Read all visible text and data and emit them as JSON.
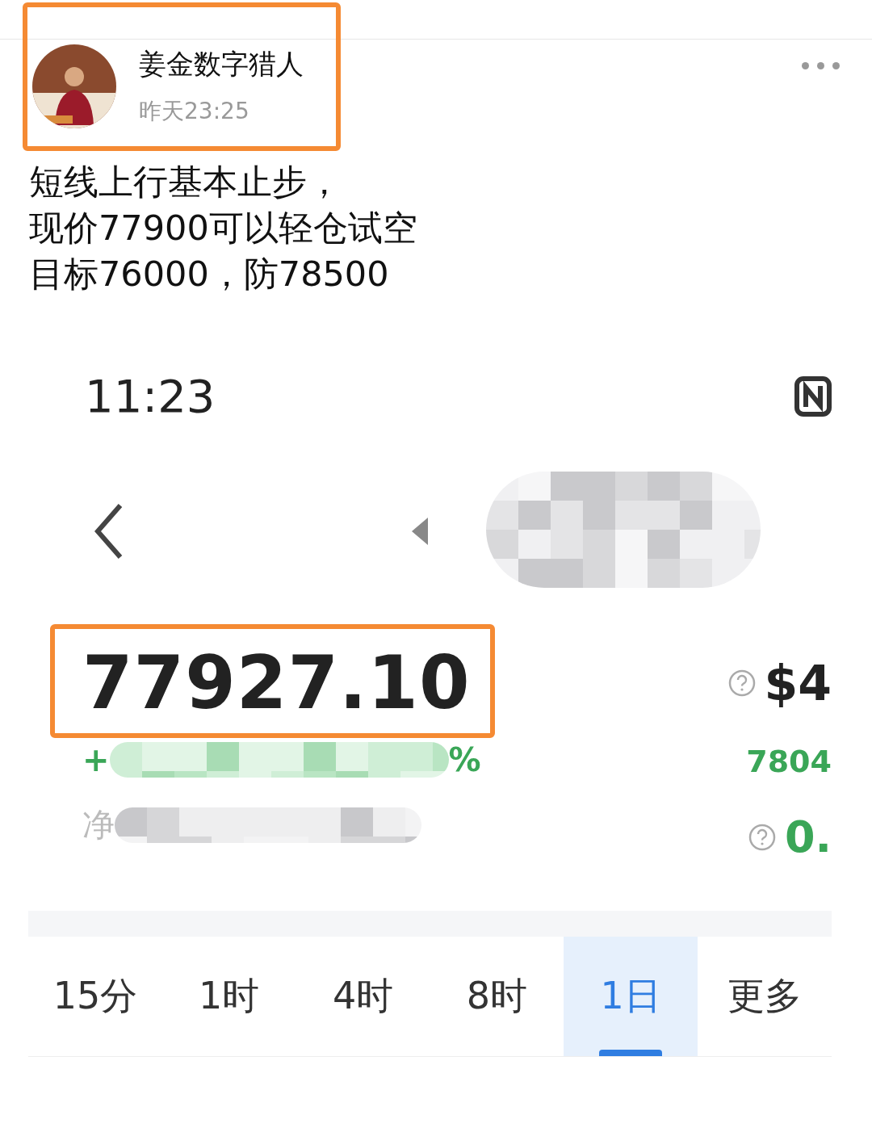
{
  "author": {
    "name": "姜金数字猎人",
    "time": "昨天23:25"
  },
  "post": {
    "lines": [
      "短线上行基本止步，",
      "现价77900可以轻仓试空",
      "目标76000，防78500"
    ]
  },
  "screenshot": {
    "status_time": "11:23",
    "price": "77927.10",
    "change_prefix": "+",
    "change_suffix": "%",
    "label_fragment": "净",
    "right_values": [
      {
        "text": "$4",
        "kind": "bold"
      },
      {
        "text": "7804",
        "kind": "green"
      },
      {
        "text": "0.",
        "kind": "green-large"
      }
    ],
    "tabs": [
      {
        "label": "15分",
        "selected": false
      },
      {
        "label": "1时",
        "selected": false
      },
      {
        "label": "4时",
        "selected": false
      },
      {
        "label": "8时",
        "selected": false
      },
      {
        "label": "1日",
        "selected": true
      },
      {
        "label": "更多",
        "selected": false
      }
    ]
  }
}
